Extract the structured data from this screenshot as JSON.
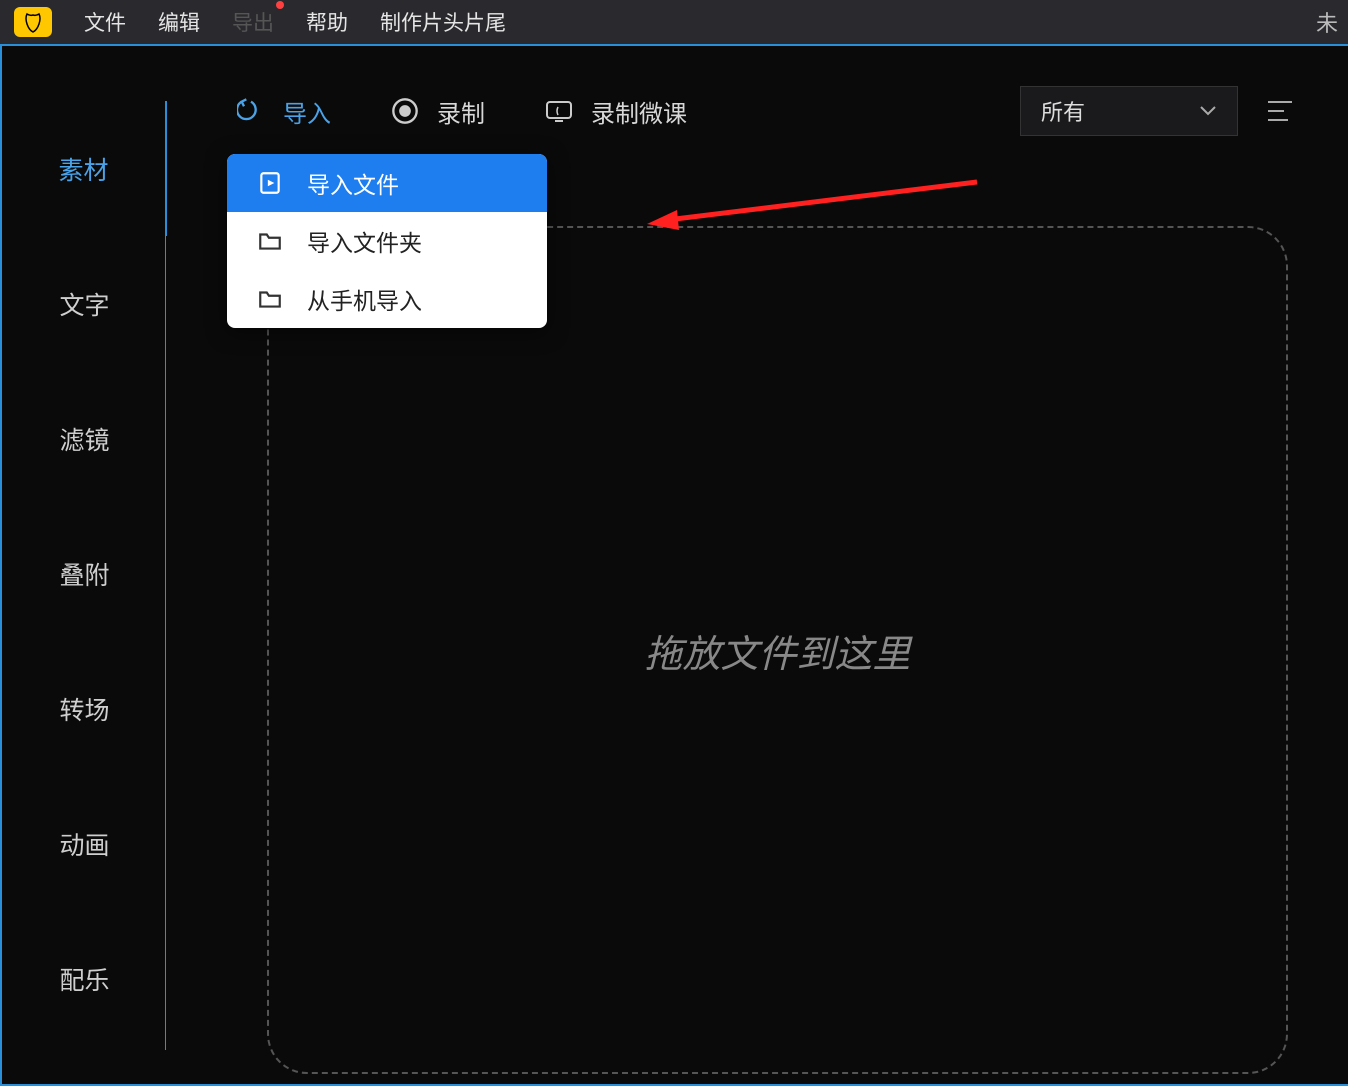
{
  "menubar": {
    "items": [
      "文件",
      "编辑",
      "导出",
      "帮助",
      "制作片头片尾"
    ],
    "disabled_index": 2,
    "dot_index": 2,
    "title_right": "未"
  },
  "sidebar": {
    "items": [
      "素材",
      "文字",
      "滤镜",
      "叠附",
      "转场",
      "动画",
      "配乐"
    ],
    "active_index": 0
  },
  "toolbar": {
    "import": "导入",
    "record": "录制",
    "record_lesson": "录制微课",
    "filter_selected": "所有"
  },
  "dropdown": {
    "items": [
      {
        "label": "导入文件",
        "icon": "file-play-icon"
      },
      {
        "label": "导入文件夹",
        "icon": "folder-icon"
      },
      {
        "label": "从手机导入",
        "icon": "folder-icon"
      }
    ],
    "active_index": 0
  },
  "dropzone": {
    "text": "拖放文件到这里"
  }
}
